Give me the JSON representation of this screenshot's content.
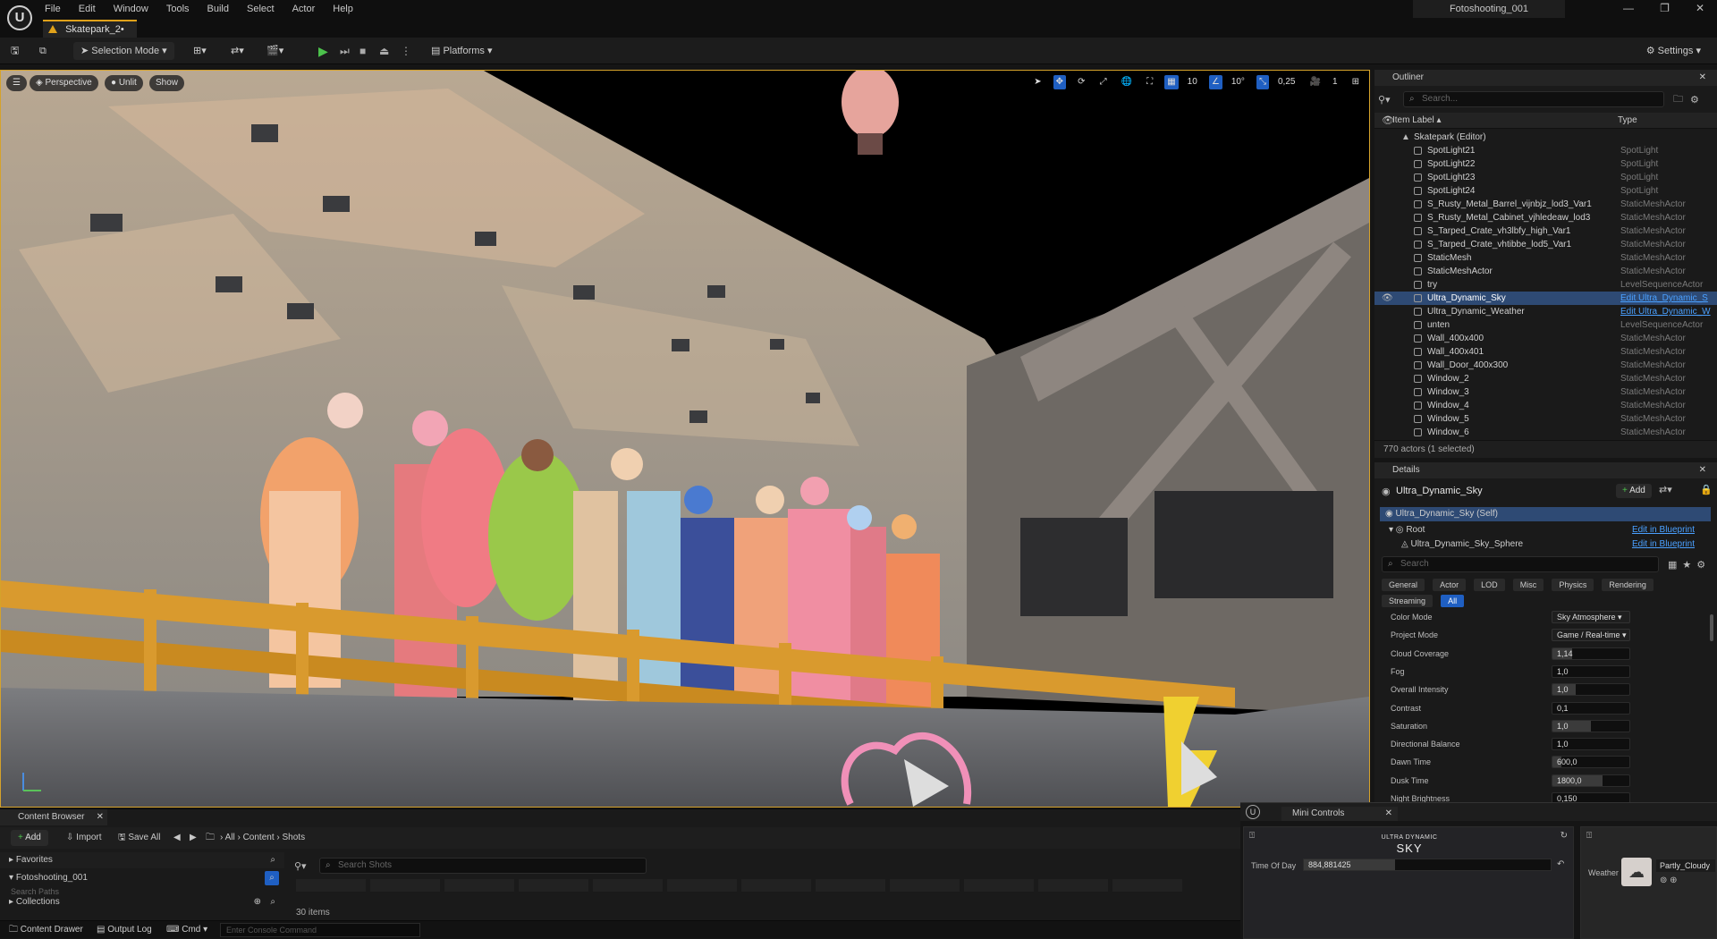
{
  "menu": [
    "File",
    "Edit",
    "Window",
    "Tools",
    "Build",
    "Select",
    "Actor",
    "Help"
  ],
  "level_tab": "Skatepark_2•",
  "project_name": "Fotoshooting_001",
  "window_controls": [
    "—",
    "❐",
    "✕"
  ],
  "toolbar": {
    "selection_mode": "Selection Mode",
    "platforms": "Platforms",
    "settings": "Settings"
  },
  "viewport": {
    "perspective": "Perspective",
    "unlit": "Unlit",
    "show": "Show",
    "grid_snap": "10",
    "rot_snap": "10°",
    "scale_snap": "0,25",
    "camera_speed": "1"
  },
  "outliner": {
    "tab": "Outliner",
    "search_placeholder": "Search...",
    "col_label": "Item Label",
    "col_type": "Type",
    "root": "Skatepark (Editor)",
    "rows": [
      {
        "label": "SpotLight21",
        "type": "SpotLight"
      },
      {
        "label": "SpotLight22",
        "type": "SpotLight"
      },
      {
        "label": "SpotLight23",
        "type": "SpotLight"
      },
      {
        "label": "SpotLight24",
        "type": "SpotLight"
      },
      {
        "label": "S_Rusty_Metal_Barrel_vijnbjz_lod3_Var1",
        "type": "StaticMeshActor"
      },
      {
        "label": "S_Rusty_Metal_Cabinet_vjhledeaw_lod3",
        "type": "StaticMeshActor"
      },
      {
        "label": "S_Tarped_Crate_vh3lbfy_high_Var1",
        "type": "StaticMeshActor"
      },
      {
        "label": "S_Tarped_Crate_vhtibbe_lod5_Var1",
        "type": "StaticMeshActor"
      },
      {
        "label": "StaticMesh",
        "type": "StaticMeshActor"
      },
      {
        "label": "StaticMeshActor",
        "type": "StaticMeshActor"
      },
      {
        "label": "try",
        "type": "LevelSequenceActor"
      },
      {
        "label": "Ultra_Dynamic_Sky",
        "type": "Edit Ultra_Dynamic_S"
      },
      {
        "label": "Ultra_Dynamic_Weather",
        "type": "Edit Ultra_Dynamic_W"
      },
      {
        "label": "unten",
        "type": "LevelSequenceActor"
      },
      {
        "label": "Wall_400x400",
        "type": "StaticMeshActor"
      },
      {
        "label": "Wall_400x401",
        "type": "StaticMeshActor"
      },
      {
        "label": "Wall_Door_400x300",
        "type": "StaticMeshActor"
      },
      {
        "label": "Window_2",
        "type": "StaticMeshActor"
      },
      {
        "label": "Window_3",
        "type": "StaticMeshActor"
      },
      {
        "label": "Window_4",
        "type": "StaticMeshActor"
      },
      {
        "label": "Window_5",
        "type": "StaticMeshActor"
      },
      {
        "label": "Window_6",
        "type": "StaticMeshActor"
      }
    ],
    "footer": "770 actors (1 selected)"
  },
  "details": {
    "tab": "Details",
    "actor_name": "Ultra_Dynamic_Sky",
    "add": "Add",
    "self": "Ultra_Dynamic_Sky (Self)",
    "root": "Root",
    "edit_bp": "Edit in Blueprint",
    "sphere": "Ultra_Dynamic_Sky_Sphere",
    "search_placeholder": "Search",
    "categories": [
      "General",
      "Actor",
      "LOD",
      "Misc",
      "Physics",
      "Rendering"
    ],
    "categories2": [
      "Streaming",
      "All"
    ],
    "props": [
      {
        "label": "Color Mode",
        "value": "Sky Atmosphere",
        "kind": "dropdown"
      },
      {
        "label": "Project Mode",
        "value": "Game / Real-time",
        "kind": "dropdown"
      },
      {
        "label": "Cloud Coverage",
        "value": "1,14",
        "level": 0.25
      },
      {
        "label": "Fog",
        "value": "1,0",
        "level": 0
      },
      {
        "label": "Overall Intensity",
        "value": "1,0",
        "level": 0.3
      },
      {
        "label": "Contrast",
        "value": "0,1",
        "level": 0
      },
      {
        "label": "Saturation",
        "value": "1,0",
        "level": 0.5
      },
      {
        "label": "Directional Balance",
        "value": "1,0",
        "level": 0
      },
      {
        "label": "Dawn Time",
        "value": "600,0",
        "level": 0.12
      },
      {
        "label": "Dusk Time",
        "value": "1800,0",
        "level": 0.65
      },
      {
        "label": "Night Brightness",
        "value": "0,150",
        "level": 0
      }
    ]
  },
  "content_browser": {
    "tab": "Content Browser",
    "add": "Add",
    "import": "Import",
    "save_all": "Save All",
    "path": [
      "All",
      "Content",
      "Shots"
    ],
    "favorites": "Favorites",
    "project": "Fotoshooting_001",
    "search_paths": "Search Paths",
    "collections": "Collections",
    "search_placeholder": "Search Shots",
    "items": "30 items"
  },
  "status_bar": {
    "content_drawer": "Content Drawer",
    "output_log": "Output Log",
    "cmd": "Cmd",
    "console_placeholder": "Enter Console Command"
  },
  "mini_controls": {
    "tab": "Mini Controls",
    "logo_top": "ULTRA DYNAMIC",
    "logo_bottom": "SKY",
    "time_of_day_label": "Time Of Day",
    "time_of_day_value": "884,881425",
    "time_of_day_level": 0.37,
    "weather_label": "Weather",
    "weather_value": "Partly_Cloudy"
  }
}
